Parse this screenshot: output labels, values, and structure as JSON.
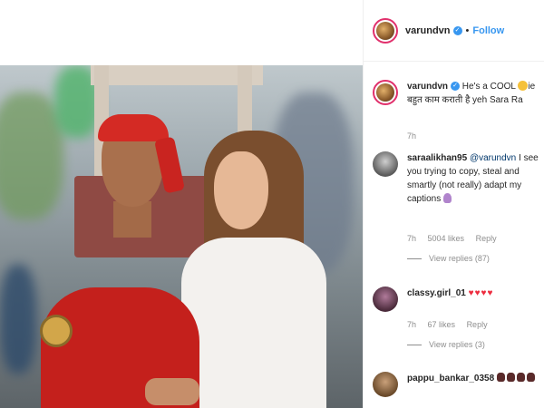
{
  "post": {
    "owner": "varundvn",
    "follow_label": "Follow",
    "separator": "•"
  },
  "comments": [
    {
      "username": "varundvn",
      "text_before": "He's a COOL ",
      "emoji": "cool-face-emoji",
      "text_after": "ie बहुत काम कराती है yeh Sara Ra",
      "time": "7h"
    },
    {
      "username": "saraalikhan95",
      "mention": "@varundvn",
      "text": " I see you trying to copy, steal and smartly (not really) adapt my captions ",
      "emoji": "person-emoji",
      "time": "7h",
      "likes": "5004 likes",
      "reply_label": "Reply",
      "view_replies": "View replies (87)"
    },
    {
      "username": "classy.girl_01",
      "text": "♥♥♥♥",
      "time": "7h",
      "likes": "67 likes",
      "reply_label": "Reply",
      "view_replies": "View replies (3)"
    },
    {
      "username": "pappu_bankar_0358",
      "emoji": "skull-emoji"
    }
  ],
  "colors": {
    "link_blue": "#3897f0",
    "heart_red": "#ed2d3f",
    "muted": "#8e8e8e"
  }
}
